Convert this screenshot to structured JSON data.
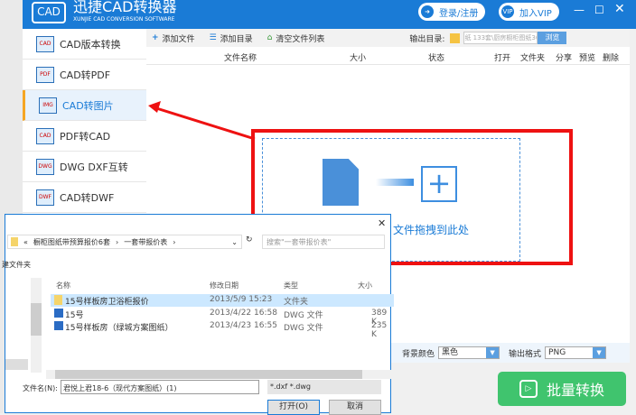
{
  "app": {
    "title": "迅捷CAD转换器",
    "subtitle": "XUNJIE CAD CONVERSION SOFTWARE",
    "logo": "CAD",
    "login": "登录/注册",
    "vip": "加入VIP",
    "vip_badge": "VIP"
  },
  "sidebar": {
    "items": [
      {
        "label": "CAD版本转换",
        "icon": "CAD"
      },
      {
        "label": "CAD转PDF",
        "icon": "PDF"
      },
      {
        "label": "CAD转图片",
        "icon": "IMG"
      },
      {
        "label": "PDF转CAD",
        "icon": "CAD"
      },
      {
        "label": "DWG DXF互转",
        "icon": "DWG"
      },
      {
        "label": "CAD转DWF",
        "icon": "DWF"
      }
    ]
  },
  "toolbar": {
    "add_file": "添加文件",
    "add_dir": "添加目录",
    "clear": "清空文件列表",
    "output_label": "输出目录:",
    "output_path": "纸 133套\\厨房橱柜图纸36套",
    "browse": "浏览"
  },
  "columns": [
    "文件名称",
    "大小",
    "状态",
    "打开",
    "文件夹",
    "分享",
    "预览",
    "删除"
  ],
  "drop": {
    "text": "文件拖拽到此处"
  },
  "options": {
    "bg_label": "背景颜色",
    "bg_value": "黑色",
    "fmt_label": "输出格式",
    "fmt_value": "PNG"
  },
  "convert": "批量转换",
  "dialog": {
    "breadcrumb": [
      "«",
      "橱柜图纸带预算报价6套",
      "一套带报价表"
    ],
    "search_placeholder": "搜索\"一套带报价表\"",
    "new_folder": "建文件夹",
    "headers": [
      "名称",
      "修改日期",
      "类型",
      "大小"
    ],
    "files": [
      {
        "name": "15号样板房卫浴柜报价",
        "date": "2013/5/9 15:23",
        "type": "文件夹",
        "size": ""
      },
      {
        "name": "15号",
        "date": "2013/4/22 16:58",
        "type": "DWG 文件",
        "size": "389 K"
      },
      {
        "name": "15号样板房（绿城方案图纸）",
        "date": "2013/4/23 16:55",
        "type": "DWG 文件",
        "size": "235 K"
      }
    ],
    "filename_label": "文件名(N):",
    "filename_value": "君悦上君18-6（现代方案图纸）(1)",
    "filter": "*.dxf *.dwg",
    "open": "打开(O)",
    "cancel": "取消"
  }
}
